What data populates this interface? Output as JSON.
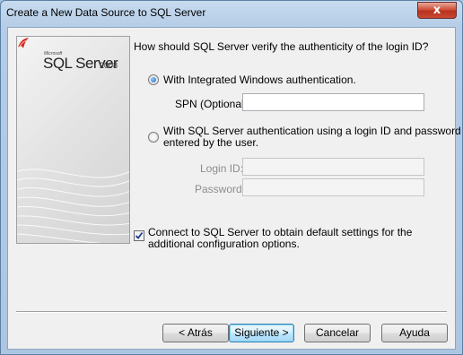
{
  "window": {
    "title": "Create a New Data Source to SQL Server",
    "close_glyph": "x"
  },
  "banner": {
    "logo_company": "Microsoft",
    "logo_product": "SQL Server",
    "logo_version": "2008"
  },
  "auth": {
    "question": "How should SQL Server verify the authenticity of the login ID?",
    "option_windows": "With Integrated Windows authentication.",
    "spn_label": "SPN (Optional):",
    "spn_value": "",
    "option_sql_line1": "With SQL Server authentication using a login ID and password",
    "option_sql_line2": "entered by the user.",
    "login_label": "Login ID:",
    "login_value": "",
    "password_label": "Password:",
    "password_value": "",
    "selected": "windows"
  },
  "connect": {
    "label_line1": "Connect to SQL Server to obtain default settings for the",
    "label_line2": "additional configuration options.",
    "checked": true
  },
  "buttons": {
    "back": "< Atrás",
    "next": "Siguiente >",
    "cancel": "Cancelar",
    "help": "Ayuda"
  }
}
